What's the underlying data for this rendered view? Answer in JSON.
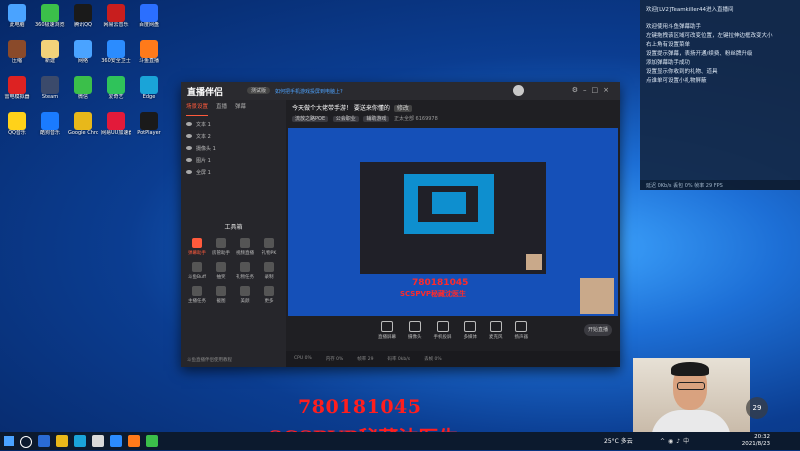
{
  "desktop_icons": [
    {
      "label": "此电脑",
      "color": "#4aa3ff"
    },
    {
      "label": "360极速浏览器",
      "color": "#3bbf4a"
    },
    {
      "label": "腾讯QQ",
      "color": "#1a1a1a"
    },
    {
      "label": "网易云音乐",
      "color": "#c81e1e"
    },
    {
      "label": "百度网盘",
      "color": "#2b6fff"
    },
    {
      "label": "压缩",
      "color": "#8a4a2a"
    },
    {
      "label": "新建",
      "color": "#f2d27a"
    },
    {
      "label": "网络",
      "color": "#4aa3ff"
    },
    {
      "label": "360安全卫士",
      "color": "#2b8cff"
    },
    {
      "label": "斗鱼直播",
      "color": "#ff7a1a"
    },
    {
      "label": "雷电模拟器",
      "color": "#d22"
    },
    {
      "label": "Steam",
      "color": "#3b4a6b"
    },
    {
      "label": "微信",
      "color": "#3bbf4a"
    },
    {
      "label": "爱奇艺",
      "color": "#2fc35a"
    },
    {
      "label": "Edge",
      "color": "#1aa4d8"
    },
    {
      "label": "QQ音乐",
      "color": "#ffd21a"
    },
    {
      "label": "酷狗音乐",
      "color": "#1a7bff"
    },
    {
      "label": "Google Chrome",
      "color": "#e8b81a"
    },
    {
      "label": "网易UU加速器",
      "color": "#e31a3a"
    },
    {
      "label": "PotPlayer",
      "color": "#1a1a1a"
    }
  ],
  "chat": {
    "lines": [
      "欢迎[LV2]Teamkiller44进入直播间",
      "欢迎使用斗鱼弹幕助手",
      "左键拖拽该区域可改变位置，左键拉伸边框改变大小",
      "右上角有设置菜单",
      "设置提示弹幕，表扬开通/续费、粉丝牌升级",
      "添加弹幕助手成功",
      "设置显示你收到的礼物、道具",
      "点谁单可设置小礼物屏蔽"
    ],
    "status": "延迟 0Kb/s 丢包 0% 帧率 29 FPS"
  },
  "app": {
    "logo": "直播伴侣",
    "beta": "测试版",
    "help_link": "如何把手机游戏投屏到电脑上?",
    "side_tabs": [
      "场景设置",
      "直播",
      "弹幕"
    ],
    "scenes": [
      "文本 1",
      "文本 2",
      "摄像头 1",
      "图片 1",
      "全屏 1"
    ],
    "toolbox_title": "工具箱",
    "tools": [
      {
        "label": "弹幕助手",
        "hot": true
      },
      {
        "label": "房管助手",
        "hot": false
      },
      {
        "label": "视频直播",
        "hot": false
      },
      {
        "label": "",
        "hot": false
      },
      {
        "label": "礼物PK",
        "hot": false
      },
      {
        "label": "斗鱼Buff",
        "hot": false
      },
      {
        "label": "抽奖",
        "hot": false
      },
      {
        "label": "",
        "hot": false
      },
      {
        "label": "礼物任务",
        "hot": false
      },
      {
        "label": "录制",
        "hot": false
      },
      {
        "label": "主播任务",
        "hot": false
      },
      {
        "label": "",
        "hot": false
      },
      {
        "label": "截图",
        "hot": false
      },
      {
        "label": "美颜",
        "hot": false
      },
      {
        "label": "更多",
        "hot": false
      },
      {
        "label": "",
        "hot": false
      }
    ],
    "side_footer": "斗鱼直播伴侣使用教程",
    "room_title": "今天做个大佬带手游！  要送来你懂的",
    "room_tag": "修改",
    "room_chips": [
      "流放之路POE",
      "公会职业",
      "辅助游戏"
    ],
    "room_meta": "正太全部  6169978",
    "overlay_number": "780181045",
    "overlay_sub": "SCSPVP秘藏沈医生",
    "controls": [
      "直播屏幕",
      "摄像头",
      "手机投屏",
      "多媒体",
      "麦克风",
      "扬声器"
    ],
    "start_button": "开始直播",
    "status_items": [
      "CPU 0%",
      "内存 0%",
      "帧率 29",
      "码率 0kb/s",
      "丢帧 0%"
    ]
  },
  "overlay": {
    "number": "780181045",
    "sub": "SCSPVP秘藏沈医生"
  },
  "viewer_badge": "29",
  "taskbar": {
    "weather": "25°C 多云",
    "time": "20:32",
    "date": "2021/8/23"
  }
}
